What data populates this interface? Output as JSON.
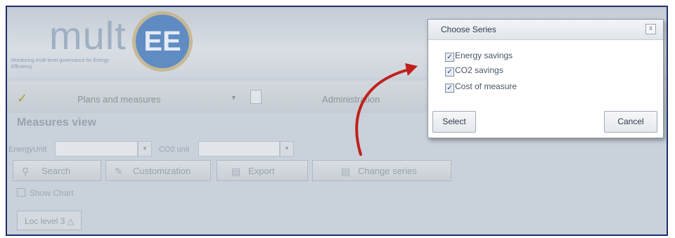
{
  "app": {
    "logo_text": "mult",
    "logo_badge": "EE",
    "tagline": "Monitoring multi-level governance for Energy Efficiency",
    "menu": {
      "plans_label": "Plans and measures",
      "admin_label": "Administration"
    },
    "view_title": "Measures view",
    "filters": {
      "energy_unit_label": "EnergyUnit",
      "co2_unit_label": "CO2 unit"
    },
    "toolbar": {
      "search_label": "Search",
      "customization_label": "Customization",
      "export_label": "Export",
      "change_series_label": "Change series"
    },
    "show_chart_label": "Show Chart",
    "loc_level_label": "Loc level 3 △"
  },
  "dialog": {
    "title": "Choose Series",
    "close_glyph": "x",
    "options": [
      {
        "label": "Energy savings",
        "checked": true
      },
      {
        "label": "CO2 savings",
        "checked": true
      },
      {
        "label": "Cost of measure",
        "checked": true
      }
    ],
    "select_label": "Select",
    "cancel_label": "Cancel"
  },
  "colors": {
    "frame_border": "#1c2e6c",
    "arrow": "#c0201c",
    "logo_blue": "#4c7fbf"
  },
  "icons": [
    "chart-icon",
    "document-icon",
    "search-icon",
    "customization-icon",
    "export-icon",
    "change-series-icon",
    "close-icon",
    "checkbox-icon",
    "arrow-annotation"
  ]
}
